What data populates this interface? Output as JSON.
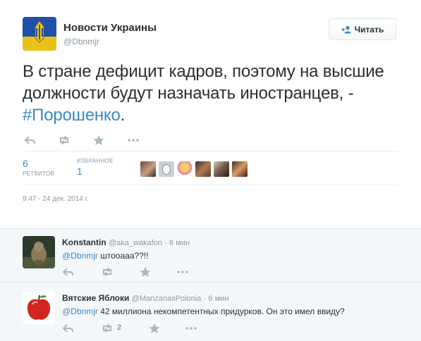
{
  "tweet": {
    "author_name": "Новости Украины",
    "author_handle": "@Dbnmjr",
    "follow_label": "Читать",
    "text": "В стране дефицит кадров, поэтому на высшие должности будут назначать иностранцев, - ",
    "hashtag": "#Порошенко",
    "text_end": ".",
    "retweets_count": "6",
    "retweets_label": "РЕТВИТОВ",
    "favorites_count": "1",
    "favorites_label": "ИЗБРАННОЕ",
    "timestamp": "9:47 - 24 дек. 2014 г."
  },
  "replies": [
    {
      "name": "Konstantin",
      "handle": "@aka_wakafon",
      "time": "· 6 мин",
      "mention": "@Dbnmjr",
      "text": " штоoааа??!!",
      "retweet_count": ""
    },
    {
      "name": "Вятские Яблоки",
      "handle": "@ManzanasPolonia",
      "time": "· 6 мин",
      "mention": "@Dbnmjr",
      "text": " 42 миллиона некомпетентных придурков. Он это имел ввиду?",
      "retweet_count": "2"
    }
  ],
  "icons": [
    "reply-icon",
    "retweet-icon",
    "favorite-icon",
    "more-icon",
    "follow-person-icon"
  ],
  "colors": {
    "link": "#3b88c3",
    "muted": "#8899a6",
    "text": "#292f33",
    "reply_bg": "#f5f8fa"
  }
}
